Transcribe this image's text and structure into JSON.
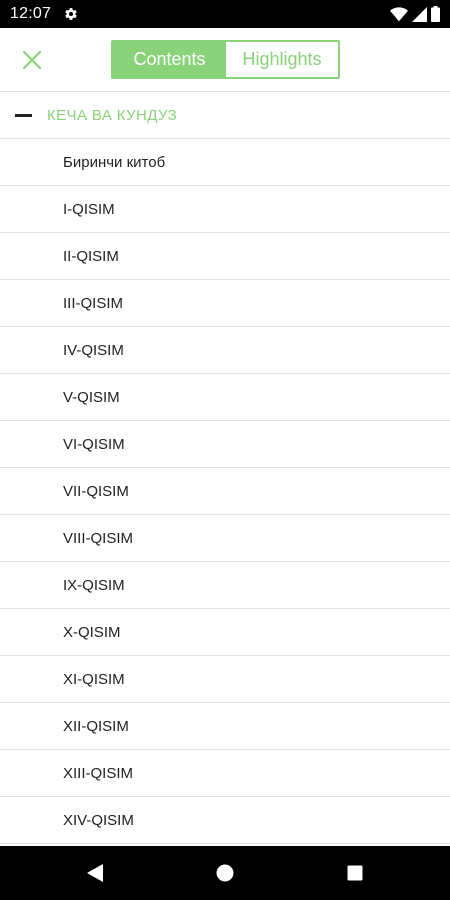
{
  "status_bar": {
    "time": "12:07",
    "icons": [
      "settings-gear-icon",
      "wifi-icon",
      "cellular-signal-icon",
      "battery-icon"
    ]
  },
  "header": {
    "close_icon": "close-icon",
    "tabs": [
      {
        "label": "Contents",
        "selected": true
      },
      {
        "label": "Highlights",
        "selected": false
      }
    ]
  },
  "colors": {
    "accent": "#8bd37a",
    "text": "#222222",
    "divider": "#e3e3e3"
  },
  "toc": {
    "group_title": "КЕЧА ВА КУНДУЗ",
    "group_expanded": true,
    "items": [
      "Биринчи китоб",
      "I-QISIM",
      "II-QISIM",
      "III-QISIM",
      "IV-QISIM",
      "V-QISIM",
      "VI-QISIM",
      "VII-QISIM",
      "VIII-QISIM",
      "IX-QISIM",
      "X-QISIM",
      "XI-QISIM",
      "XII-QISIM",
      "XIII-QISIM",
      "XIV-QISIM"
    ]
  },
  "nav_bar": {
    "buttons": [
      "back-icon",
      "home-icon",
      "recents-icon"
    ]
  }
}
